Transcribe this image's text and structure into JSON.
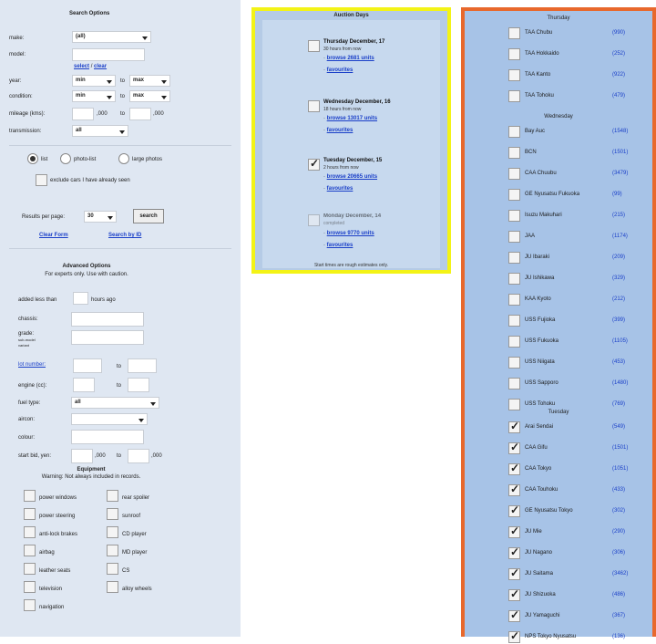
{
  "search": {
    "title": "Search Options",
    "make_label": "make:",
    "make_value": "(all)",
    "model_label": "model:",
    "select_link": "select",
    "slash": "/",
    "clear_link": "clear",
    "year_label": "year:",
    "year_min": "min",
    "to_1": "to",
    "year_max": "max",
    "condition_label": "condition:",
    "cond_min": "min",
    "to_2": "to",
    "cond_max": "max",
    "mileage_label": "mileage (kms):",
    "mileage_suffix_1": ",000",
    "to_3": "to",
    "mileage_suffix_2": ",000",
    "transmission_label": "transmission:",
    "transmission_value": "all",
    "view_list": "list",
    "view_photo": "photo-list",
    "view_large": "large photos",
    "exclude_label": "exclude cars I have already seen",
    "results_label": "Results per page:",
    "results_value": "30",
    "search_button": "search",
    "clear_form": "Clear Form",
    "search_by_id": "Search by ID"
  },
  "advanced": {
    "title": "Advanced Options",
    "subtitle": "For experts only. Use with caution.",
    "added_label": "added less than",
    "hours_ago": "hours ago",
    "chassis_label": "chassis:",
    "grade_label": "grade:",
    "grade_sub_1": "sub-model",
    "grade_sub_2": "variant",
    "lot_label": "lot number:",
    "to_lot": "to",
    "engine_label": "engine (cc):",
    "to_engine": "to",
    "fuel_label": "fuel type:",
    "fuel_value": "all",
    "aircon_label": "aircon:",
    "colour_label": "colour:",
    "start_bid_label": "start bid, yen:",
    "bid_suffix_1": ",000",
    "to_bid": "to",
    "bid_suffix_2": ",000",
    "equipment_title": "Equipment",
    "equipment_warning": "Warning: Not always included in records.",
    "equipment": [
      {
        "label": "power windows"
      },
      {
        "label": "rear spoiler"
      },
      {
        "label": "power steering"
      },
      {
        "label": "sunroof"
      },
      {
        "label": "anti-lock brakes"
      },
      {
        "label": "CD player"
      },
      {
        "label": "airbag"
      },
      {
        "label": "MD player"
      },
      {
        "label": "leather seats"
      },
      {
        "label": "CS"
      },
      {
        "label": "television"
      },
      {
        "label": "alloy wheels"
      },
      {
        "label": "navigation"
      }
    ]
  },
  "auction": {
    "title": "Auction Days",
    "days": [
      {
        "date": "Thursday December, 17",
        "note": "30 hours from now",
        "browse": "browse 2681 units",
        "fav": "favourites",
        "checked": false,
        "faded": false
      },
      {
        "date": "Wednesday December, 16",
        "note": "18 hours from now",
        "browse": "browse 13017 units",
        "fav": "favourites",
        "checked": false,
        "faded": false
      },
      {
        "date": "Tuesday December, 15",
        "note": "2 hours from now",
        "browse": "browse 20665 units",
        "fav": "favourites",
        "checked": true,
        "faded": false
      },
      {
        "date": "Monday December, 14",
        "note": "completed",
        "browse": "browse 9770 units",
        "fav": "favourites",
        "checked": false,
        "faded": true
      }
    ],
    "footnote": "Start times are rough estimates only."
  },
  "venues": {
    "thursday_title": "Thursday",
    "thursday": [
      {
        "name": "TAA Chubu",
        "count": "(990)",
        "checked": false
      },
      {
        "name": "TAA Hokkaido",
        "count": "(252)",
        "checked": false
      },
      {
        "name": "TAA Kanto",
        "count": "(922)",
        "checked": false
      },
      {
        "name": "TAA Tohoku",
        "count": "(479)",
        "checked": false
      }
    ],
    "wednesday_title": "Wednesday",
    "wednesday": [
      {
        "name": "Bay Auc",
        "count": "(1548)",
        "checked": false
      },
      {
        "name": "BCN",
        "count": "(1501)",
        "checked": false
      },
      {
        "name": "CAA Chuubu",
        "count": "(3479)",
        "checked": false
      },
      {
        "name": "GE Nyusatsu Fukuoka",
        "count": "(99)",
        "checked": false
      },
      {
        "name": "Isuzu Makuhari",
        "count": "(215)",
        "checked": false
      },
      {
        "name": "JAA",
        "count": "(1174)",
        "checked": false
      },
      {
        "name": "JU Ibaraki",
        "count": "(209)",
        "checked": false
      },
      {
        "name": "JU Ishikawa",
        "count": "(329)",
        "checked": false
      },
      {
        "name": "KAA Kyoto",
        "count": "(212)",
        "checked": false
      },
      {
        "name": "USS Fujioka",
        "count": "(399)",
        "checked": false
      },
      {
        "name": "USS Fukuoka",
        "count": "(1105)",
        "checked": false
      },
      {
        "name": "USS Niigata",
        "count": "(453)",
        "checked": false
      },
      {
        "name": "USS Sapporo",
        "count": "(1480)",
        "checked": false
      },
      {
        "name": "USS Tohoku",
        "count": "(769)",
        "checked": false
      }
    ],
    "tuesday_title": "Tuesday",
    "tuesday": [
      {
        "name": "Arai Sendai",
        "count": "(549)",
        "checked": true
      },
      {
        "name": "CAA Gifu",
        "count": "(1501)",
        "checked": true
      },
      {
        "name": "CAA Tokyo",
        "count": "(1051)",
        "checked": true
      },
      {
        "name": "CAA Touhoku",
        "count": "(433)",
        "checked": true
      },
      {
        "name": "GE Nyusatsu Tokyo",
        "count": "(302)",
        "checked": true
      },
      {
        "name": "JU Mie",
        "count": "(290)",
        "checked": true
      },
      {
        "name": "JU Nagano",
        "count": "(306)",
        "checked": true
      },
      {
        "name": "JU Saitama",
        "count": "(3462)",
        "checked": true
      },
      {
        "name": "JU Shizuoka",
        "count": "(486)",
        "checked": true
      },
      {
        "name": "JU Yamaguchi",
        "count": "(367)",
        "checked": true
      },
      {
        "name": "NPS Tokyo Nyusatsu",
        "count": "(136)",
        "checked": true
      }
    ]
  }
}
